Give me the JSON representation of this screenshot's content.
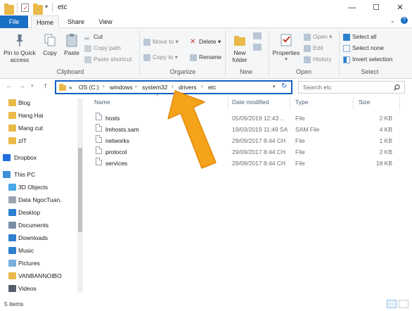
{
  "window": {
    "title": "etc",
    "minimize": "—",
    "maximize": "☐",
    "close": "✕"
  },
  "ribbon_tabs": {
    "file": "File",
    "home": "Home",
    "share": "Share",
    "view": "View"
  },
  "clipboard": {
    "pin_label": "Pin to Quick access",
    "copy": "Copy",
    "paste": "Paste",
    "cut": "Cut",
    "copy_path": "Copy path",
    "paste_shortcut": "Paste shortcut",
    "group": "Clipboard"
  },
  "organize": {
    "move_to": "Move to",
    "copy_to": "Copy to",
    "delete": "Delete",
    "rename": "Rename",
    "group": "Organize"
  },
  "new": {
    "new_folder": "New folder",
    "group": "New"
  },
  "open": {
    "properties": "Properties",
    "open": "Open",
    "edit": "Edit",
    "history": "History",
    "group": "Open"
  },
  "select": {
    "select_all": "Select all",
    "select_none": "Select none",
    "invert": "Invert selection",
    "group": "Select"
  },
  "address": {
    "overflow": "«",
    "crumbs": [
      "OS (C:)",
      "windows",
      "system32",
      "drivers",
      "etc"
    ],
    "search_placeholder": "Search etc"
  },
  "nav_pane": [
    {
      "label": "Blog",
      "icon": "folder-icon",
      "color": "#e9b949"
    },
    {
      "label": "Hang Hai",
      "icon": "folder-icon",
      "color": "#e9b949"
    },
    {
      "label": "Mang cut",
      "icon": "folder-icon",
      "color": "#e9b949"
    },
    {
      "label": "zIT",
      "icon": "folder-icon",
      "color": "#e9b949"
    },
    {
      "label": "Dropbox",
      "icon": "dropbox-icon",
      "color": "#1f6fe0"
    },
    {
      "label": "This PC",
      "icon": "computer-icon",
      "color": "#3f8fd8"
    },
    {
      "label": "3D Objects",
      "icon": "3d-objects-icon",
      "color": "#4aa9e8"
    },
    {
      "label": "Data NgocTuan.",
      "icon": "drive-icon",
      "color": "#9aa5b1"
    },
    {
      "label": "Desktop",
      "icon": "desktop-icon",
      "color": "#2d7fd0"
    },
    {
      "label": "Documents",
      "icon": "documents-icon",
      "color": "#7a8ea6"
    },
    {
      "label": "Downloads",
      "icon": "downloads-icon",
      "color": "#2d7fd0"
    },
    {
      "label": "Music",
      "icon": "music-icon",
      "color": "#2d7fd0"
    },
    {
      "label": "Pictures",
      "icon": "pictures-icon",
      "color": "#7aaedc"
    },
    {
      "label": "VANBANNOIBO",
      "icon": "folder-icon",
      "color": "#e9b949"
    },
    {
      "label": "Videos",
      "icon": "videos-icon",
      "color": "#555f6b"
    }
  ],
  "columns": {
    "name": "Name",
    "date": "Date modified",
    "type": "Type",
    "size": "Size"
  },
  "files": [
    {
      "name": "hosts",
      "date": "05/09/2019 12:43 ...",
      "type": "File",
      "size": "2 KB"
    },
    {
      "name": "lmhosts.sam",
      "date": "19/03/2019 11:49 SA",
      "type": "SAM File",
      "size": "4 KB"
    },
    {
      "name": "networks",
      "date": "29/09/2017 8:44 CH",
      "type": "File",
      "size": "1 KB"
    },
    {
      "name": "protocol",
      "date": "29/09/2017 8:44 CH",
      "type": "File",
      "size": "2 KB"
    },
    {
      "name": "services",
      "date": "29/09/2017 8:44 CH",
      "type": "File",
      "size": "18 KB"
    }
  ],
  "status": {
    "items": "5 items"
  },
  "colors": {
    "accent": "#1a6fc6",
    "address_highlight": "#1560c2",
    "arrow": "#f5a31a"
  }
}
